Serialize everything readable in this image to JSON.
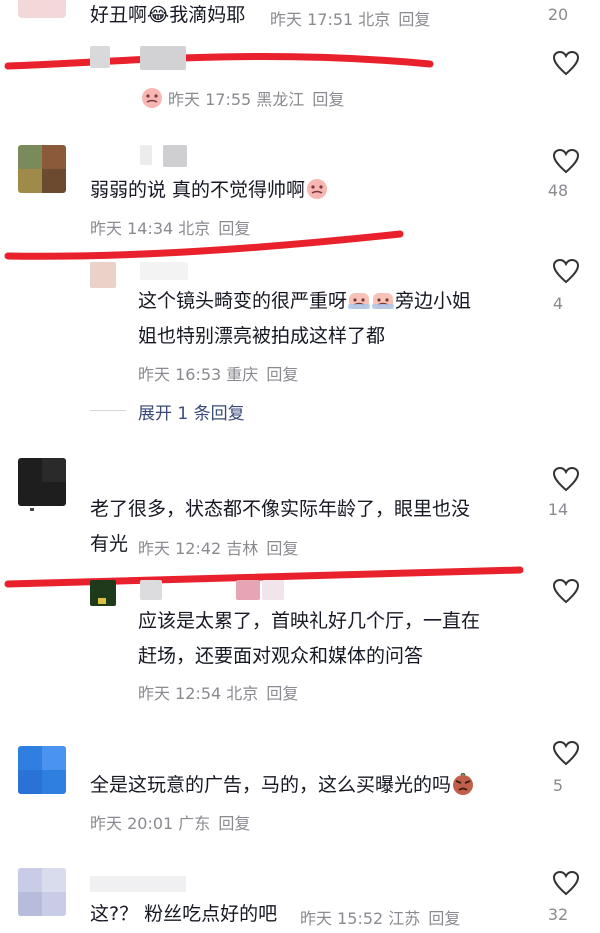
{
  "comments": [
    {
      "text": "好丑啊😂我滴妈耶",
      "meta_time": "昨天 17:51",
      "meta_location": "北京",
      "reply_label": "回复",
      "likes": "20"
    },
    {
      "text": "",
      "meta_time": "昨天 17:55",
      "meta_location": "黑龙江",
      "reply_label": "回复",
      "likes": ""
    },
    {
      "text": "弱弱的说 真的不觉得帅啊",
      "meta_time": "昨天 14:34",
      "meta_location": "北京",
      "reply_label": "回复",
      "likes": "48"
    },
    {
      "text_line1": "这个镜头畸变的很严重呀",
      "text_line1_tail": "旁边小姐",
      "text_line2": "姐也特别漂亮被拍成这样了都",
      "meta_time": "昨天 16:53",
      "meta_location": "重庆",
      "reply_label": "回复",
      "likes": "4",
      "expand_label": "展开 1 条回复"
    },
    {
      "text_line1": "老了很多，状态都不像实际年龄了，眼里也没",
      "text_line2": "有光",
      "meta_time": "昨天 12:42",
      "meta_location": "吉林",
      "reply_label": "回复",
      "likes": "14"
    },
    {
      "text_line1": "应该是太累了，首映礼好几个厅，一直在",
      "text_line2": "赶场，还要面对观众和媒体的问答",
      "meta_time": "昨天 12:54",
      "meta_location": "北京",
      "reply_label": "回复",
      "likes": ""
    },
    {
      "text": "全是这玩意的广告，马的，这么买曝光的吗",
      "meta_time": "昨天 20:01",
      "meta_location": "广东",
      "reply_label": "回复",
      "likes": "5"
    },
    {
      "text": "这?？ 粉丝吃点好的吧",
      "meta_time": "昨天 15:52",
      "meta_location": "江苏",
      "reply_label": "回复",
      "likes": "32"
    }
  ],
  "colors": {
    "annotation_red": "#e8212c",
    "text": "#161823",
    "meta": "#8a8b91",
    "expand": "#3a4a78"
  },
  "icons": {
    "like": "heart-outline-icon",
    "emoji_cry_laugh": "crying-face-emoji",
    "emoji_angry": "angry-face-emoji"
  }
}
